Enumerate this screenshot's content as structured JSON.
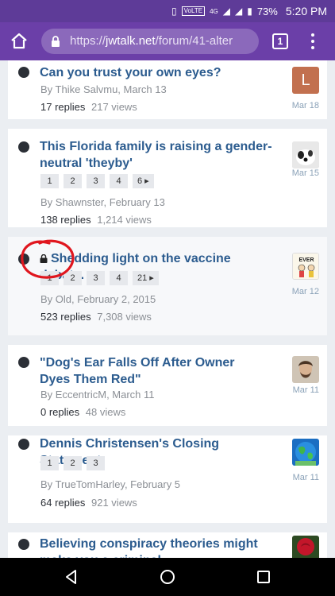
{
  "status_bar": {
    "network": "4G",
    "volte": "VoLTE",
    "battery": "73%",
    "time": "5:20 PM"
  },
  "browser": {
    "url_scheme": "https://",
    "url_host": "jwtalk.net",
    "url_path": "/forum/41-alter",
    "tab_count": "1"
  },
  "topics": [
    {
      "title": "Can you trust your own eyes?",
      "author_line": "By Thike Salvmu, March 13",
      "replies": "17 replies",
      "views": "217 views",
      "date": "Mar 18",
      "avatar_letter": "L",
      "avatar_color": "#c2704f"
    },
    {
      "title": "This Florida family is raising a gender-neutral 'theyby'",
      "pages": [
        "1",
        "2",
        "3",
        "4",
        "6"
      ],
      "author_line": "By Shawnster, February 13",
      "replies": "138 replies",
      "views": "1,214 views",
      "date": "Mar 15"
    },
    {
      "title": "Shedding light on the vaccine debate.",
      "pages": [
        "1",
        "2",
        "3",
        "4",
        "21"
      ],
      "author_line": "By Old, February 2, 2015",
      "replies": "523 replies",
      "views": "7,308 views",
      "date": "Mar 12",
      "avatar_text": "EVER"
    },
    {
      "title": "\"Dog's Ear Falls Off After Owner Dyes Them Red\"",
      "author_line": "By EccentricM, March 11",
      "replies": "0 replies",
      "views": "48 views",
      "date": "Mar 11"
    },
    {
      "title": "Dennis Christensen's Closing Statement",
      "pages": [
        "1",
        "2",
        "3"
      ],
      "author_line": "By TrueTomHarley, February 5",
      "replies": "64 replies",
      "views": "921 views",
      "date": "Mar 11"
    },
    {
      "title": "Believing conspiracy theories might make you a criminal"
    }
  ],
  "colors": {
    "header": "#6b3fa8",
    "status_bar": "#5e3b98",
    "link": "#2c5c8f",
    "annotation": "#e0161e"
  }
}
